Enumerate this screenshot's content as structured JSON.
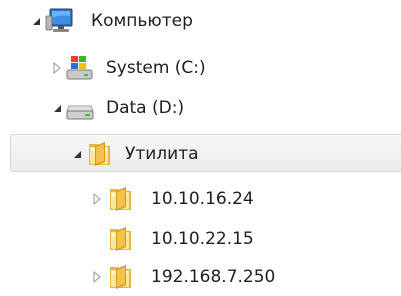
{
  "tree": {
    "items": [
      {
        "label": "Компьютер",
        "icon": "computer-icon",
        "toggle": "expanded"
      },
      {
        "label": "System (C:)",
        "icon": "system-drive-icon",
        "toggle": "collapsed"
      },
      {
        "label": "Data (D:)",
        "icon": "hard-drive-icon",
        "toggle": "expanded"
      },
      {
        "label": "Утилита",
        "icon": "folder-icon",
        "toggle": "expanded",
        "selected": true
      },
      {
        "label": "10.10.16.24",
        "icon": "folder-icon",
        "toggle": "collapsed"
      },
      {
        "label": "10.10.22.15",
        "icon": "folder-icon",
        "toggle": "none"
      },
      {
        "label": "192.168.7.250",
        "icon": "folder-icon",
        "toggle": "collapsed"
      }
    ]
  }
}
